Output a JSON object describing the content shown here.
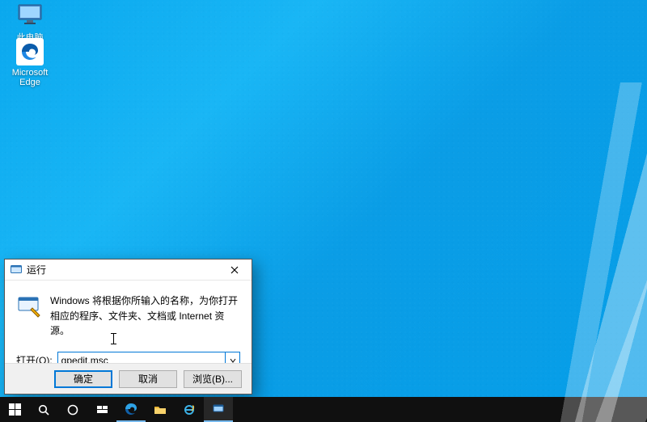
{
  "desktop": {
    "icons": {
      "this_pc": "此电脑",
      "edge": "Microsoft\nEdge"
    }
  },
  "run_dialog": {
    "title": "运行",
    "description": "Windows 将根据你所输入的名称，为你打开相应的程序、文件夹、文档或 Internet 资源。",
    "open_label": "打开(O):",
    "open_value": "gpedit.msc",
    "buttons": {
      "ok": "确定",
      "cancel": "取消",
      "browse": "浏览(B)..."
    }
  },
  "icon_names": {
    "run_titlebar": "run-dialog-icon",
    "run_body": "run-command-icon",
    "close": "close-icon"
  },
  "colors": {
    "accent": "#0078d7",
    "desktop_bg_from": "#0aa8ee",
    "desktop_bg_to": "#069ee8",
    "taskbar": "#101010"
  }
}
